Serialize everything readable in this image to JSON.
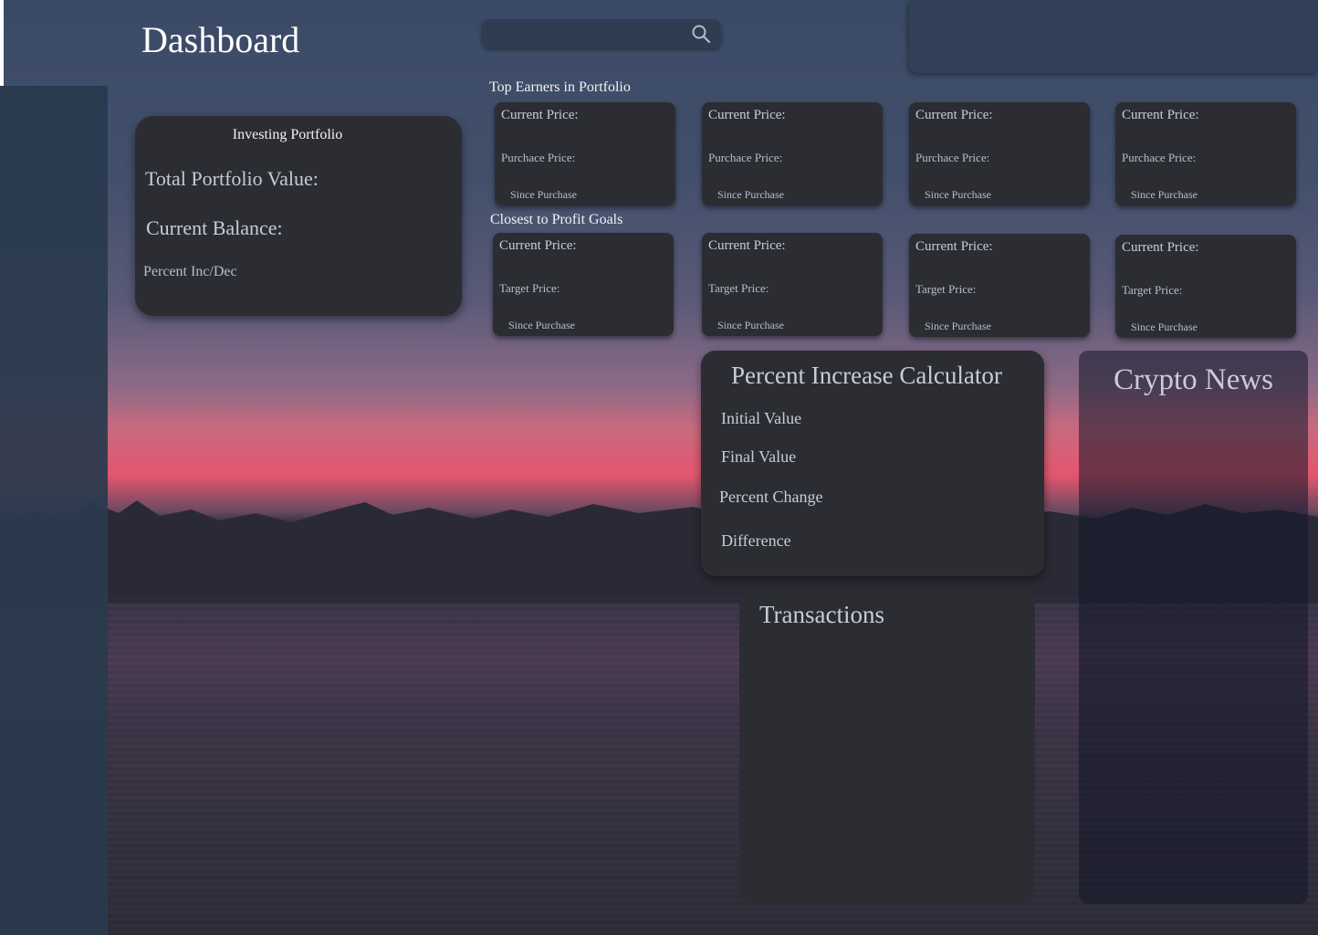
{
  "header": {
    "title": "Dashboard",
    "search": {
      "placeholder": "",
      "icon": "search-icon"
    }
  },
  "portfolio": {
    "title": "Investing Portfolio",
    "total_label": "Total Portfolio Value:",
    "balance_label": "Current Balance:",
    "percent_label": "Percent Inc/Dec"
  },
  "top_earners": {
    "label": "Top Earners in Portfolio",
    "cards": [
      {
        "line1": "Current Price:",
        "line2": "Purchace Price:",
        "line3": "Since Purchase"
      },
      {
        "line1": "Current Price:",
        "line2": "Purchace Price:",
        "line3": "Since Purchase"
      },
      {
        "line1": "Current Price:",
        "line2": "Purchace Price:",
        "line3": "Since Purchase"
      },
      {
        "line1": "Current Price:",
        "line2": "Purchace Price:",
        "line3": "Since Purchase"
      }
    ]
  },
  "profit_goals": {
    "label": "Closest to Profit Goals",
    "cards": [
      {
        "line1": "Current Price:",
        "line2": "Target Price:",
        "line3": "Since Purchase"
      },
      {
        "line1": "Current Price:",
        "line2": "Target Price:",
        "line3": "Since Purchase"
      },
      {
        "line1": "Current Price:",
        "line2": "Target Price:",
        "line3": "Since Purchase"
      },
      {
        "line1": "Current Price:",
        "line2": "Target Price:",
        "line3": "Since Purchase"
      }
    ]
  },
  "calculator": {
    "title": "Percent Increase Calculator",
    "initial": "Initial Value",
    "final": "Final Value",
    "percent_change": "Percent Change",
    "difference": "Difference"
  },
  "transactions": {
    "title": "Transactions"
  },
  "news": {
    "title": "Crypto News"
  },
  "colors": {
    "card_bg": "#2b2d33",
    "sidebar_bg": "#2a3a4e",
    "text_muted": "#c8ccd8",
    "sunset_accent": "#e4566e"
  }
}
